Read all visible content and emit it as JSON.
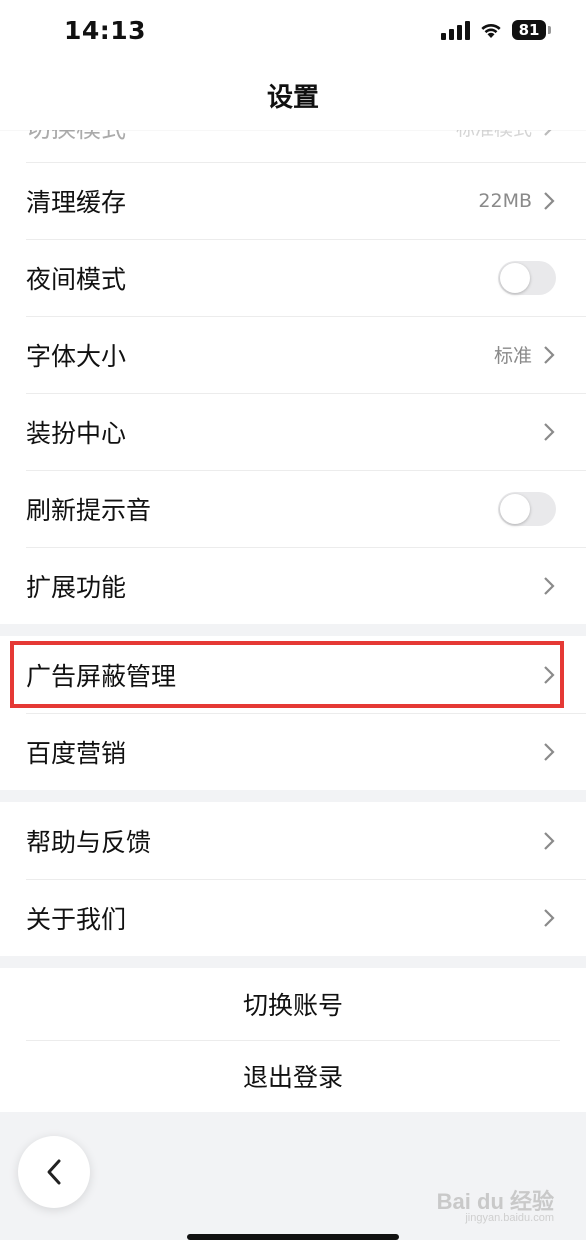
{
  "status_bar": {
    "time": "14:13",
    "battery": "81"
  },
  "nav": {
    "title": "设置"
  },
  "group1": {
    "items": [
      {
        "label": "切换模式",
        "value": "标准模式"
      },
      {
        "label": "清理缓存",
        "value": "22MB"
      },
      {
        "label": "夜间模式",
        "toggle": "off"
      },
      {
        "label": "字体大小",
        "value": "标准"
      },
      {
        "label": "装扮中心"
      },
      {
        "label": "刷新提示音",
        "toggle": "off"
      },
      {
        "label": "扩展功能"
      }
    ]
  },
  "group2": {
    "items": [
      {
        "label": "广告屏蔽管理",
        "highlighted": true
      },
      {
        "label": "百度营销"
      }
    ]
  },
  "group3": {
    "items": [
      {
        "label": "帮助与反馈"
      },
      {
        "label": "关于我们"
      }
    ]
  },
  "account": {
    "switch_label": "切换账号",
    "logout_label": "退出登录"
  },
  "watermark": {
    "logo": "Bai du 经验",
    "url": "jingyan.baidu.com"
  },
  "colors": {
    "highlight": "#e53935",
    "background": "#f2f3f5"
  }
}
